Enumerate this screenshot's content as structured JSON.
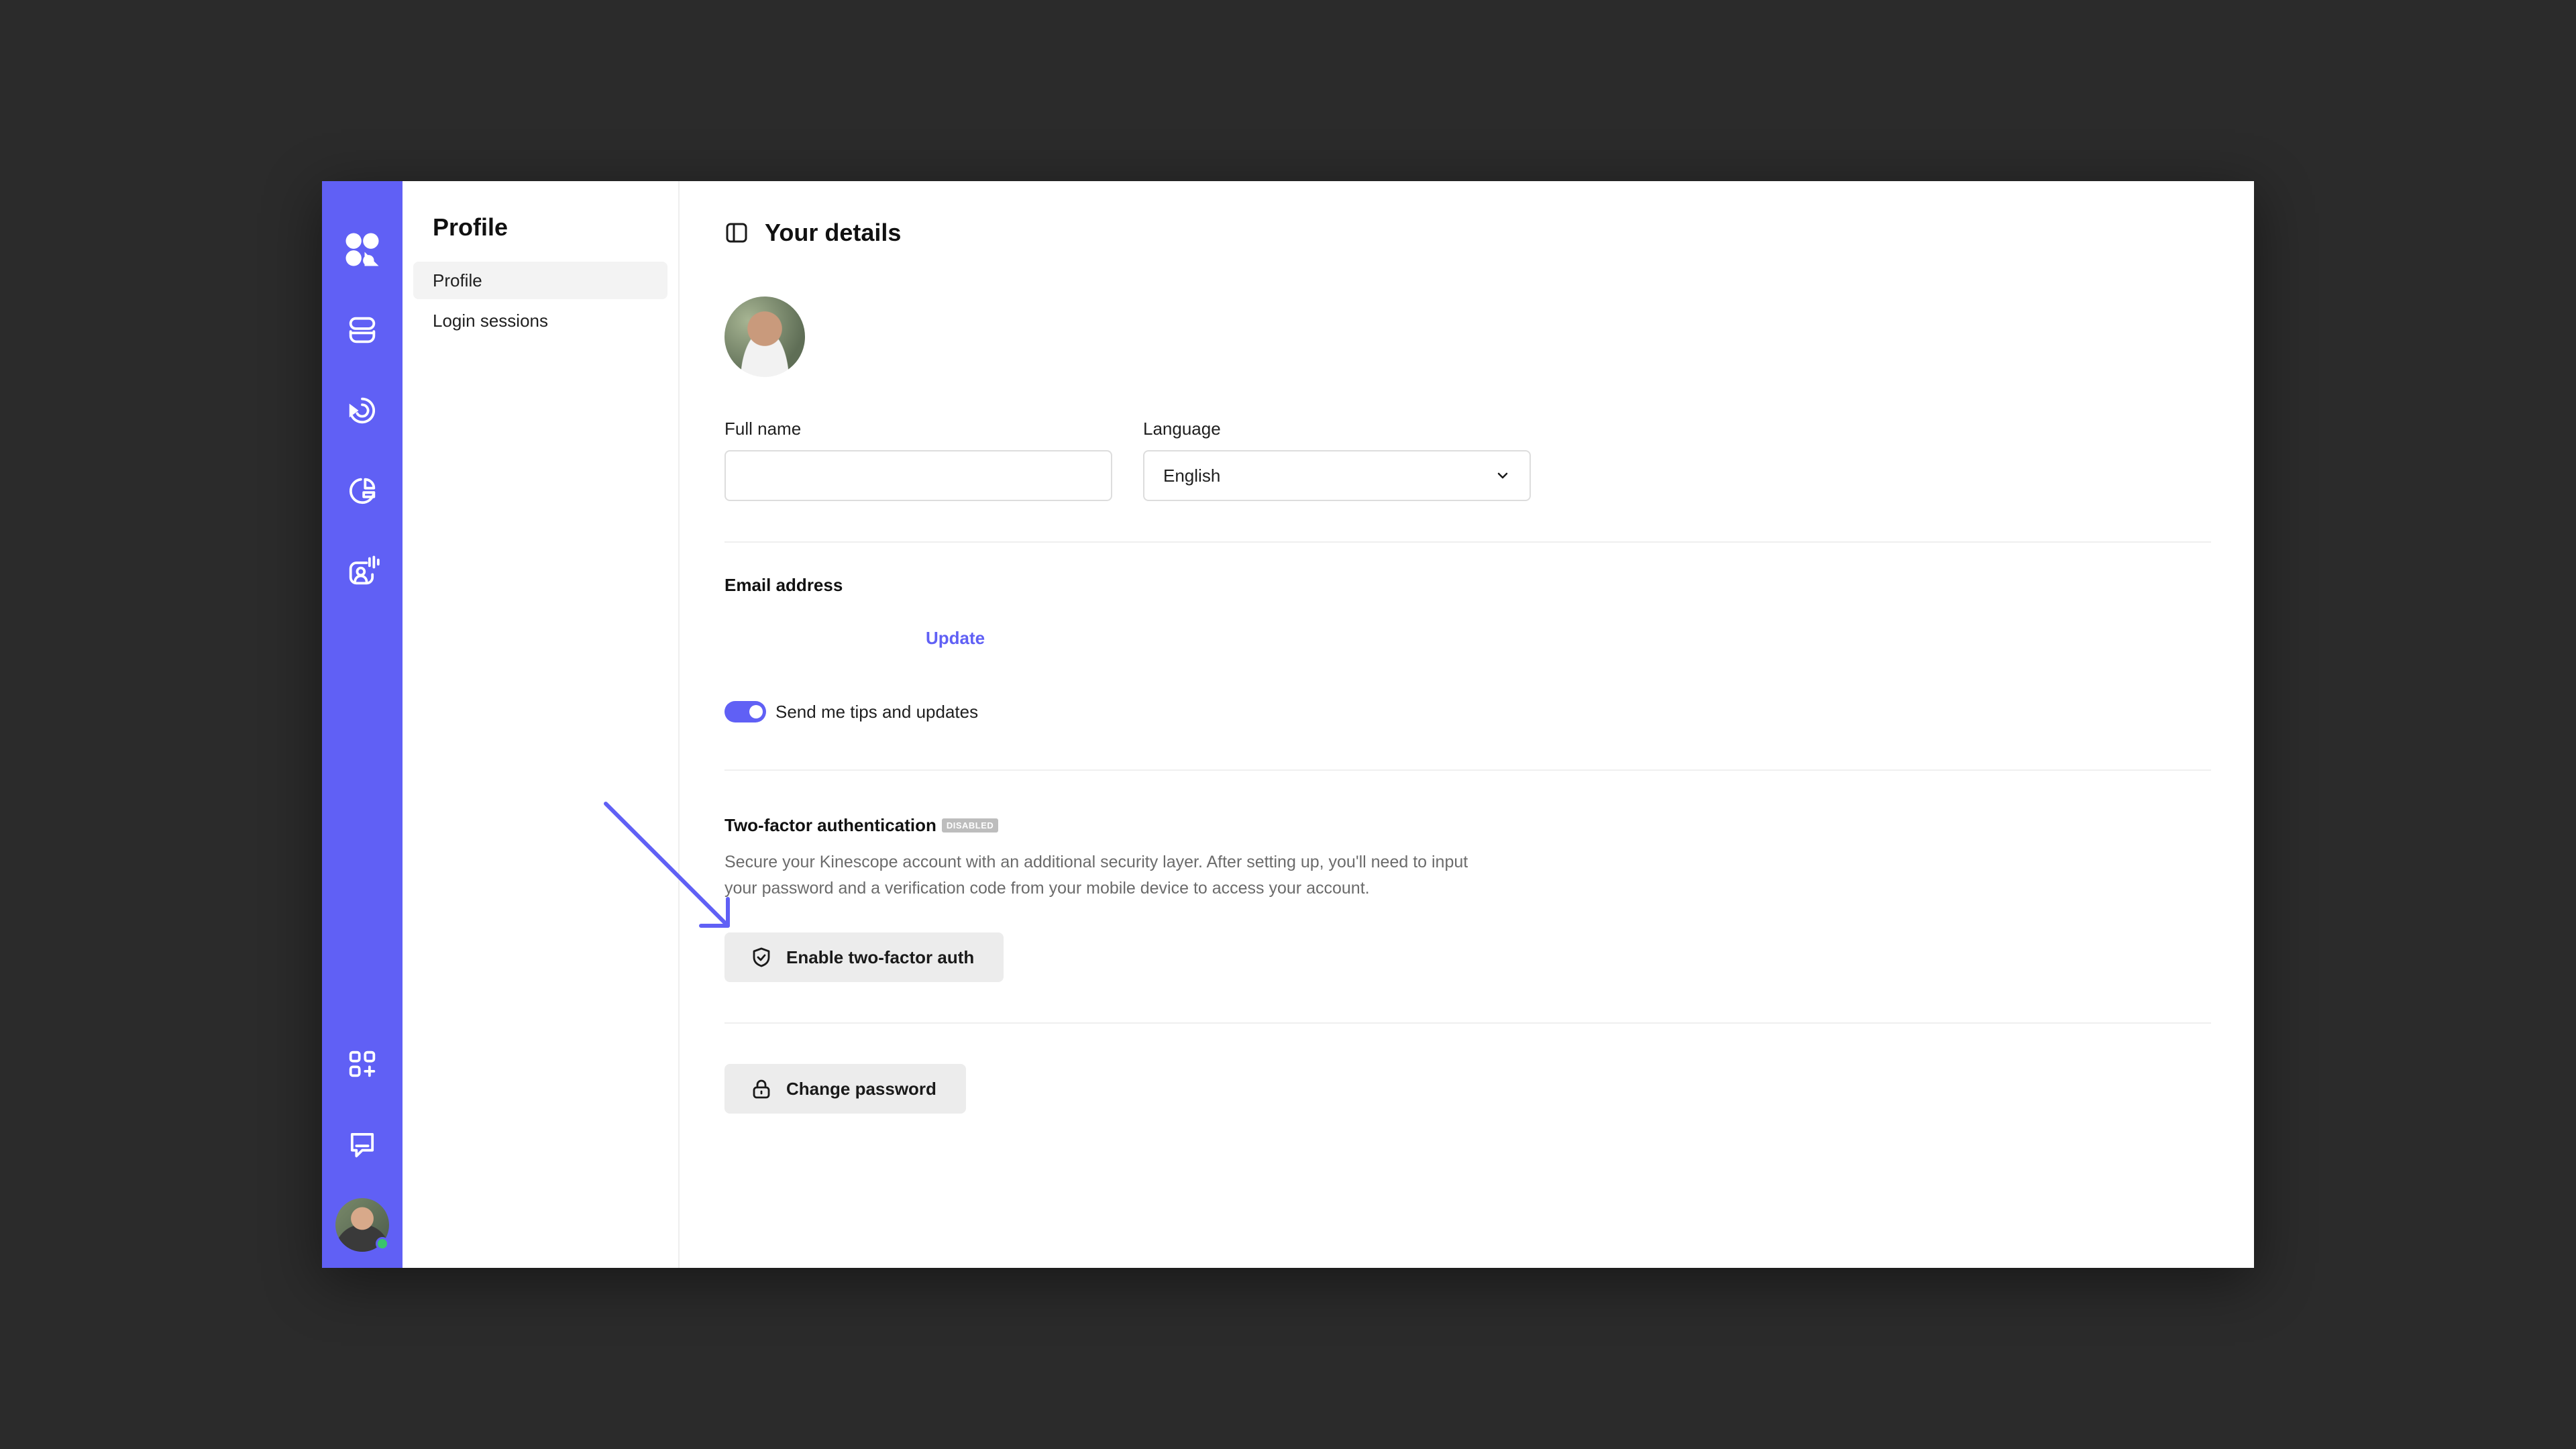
{
  "colors": {
    "accent": "#6060f5",
    "badge": "#bdbdbd",
    "muted_text": "#6b6b6b",
    "button_bg": "#ececec"
  },
  "rail": {
    "top_icons": [
      "logo-icon",
      "stack-icon",
      "broadcast-icon",
      "analytics-icon",
      "user-activity-icon"
    ],
    "bottom_icons": [
      "apps-icon",
      "chat-icon",
      "user-avatar"
    ]
  },
  "sidebar": {
    "title": "Profile",
    "items": [
      {
        "label": "Profile",
        "active": true
      },
      {
        "label": "Login sessions",
        "active": false
      }
    ]
  },
  "main": {
    "header_title": "Your details",
    "full_name": {
      "label": "Full name",
      "value": "",
      "placeholder": ""
    },
    "language": {
      "label": "Language",
      "selected": "English"
    },
    "email": {
      "title": "Email address",
      "update_label": "Update"
    },
    "tips": {
      "label": "Send me tips and updates",
      "enabled": true
    },
    "two_factor": {
      "title": "Two-factor authentication",
      "badge": "DISABLED",
      "description": "Secure your Kinescope account with an additional security layer. After setting up, you'll need to input your password and a verification code from your mobile device to access your account.",
      "button_label": "Enable two-factor auth"
    },
    "password": {
      "button_label": "Change password"
    }
  }
}
